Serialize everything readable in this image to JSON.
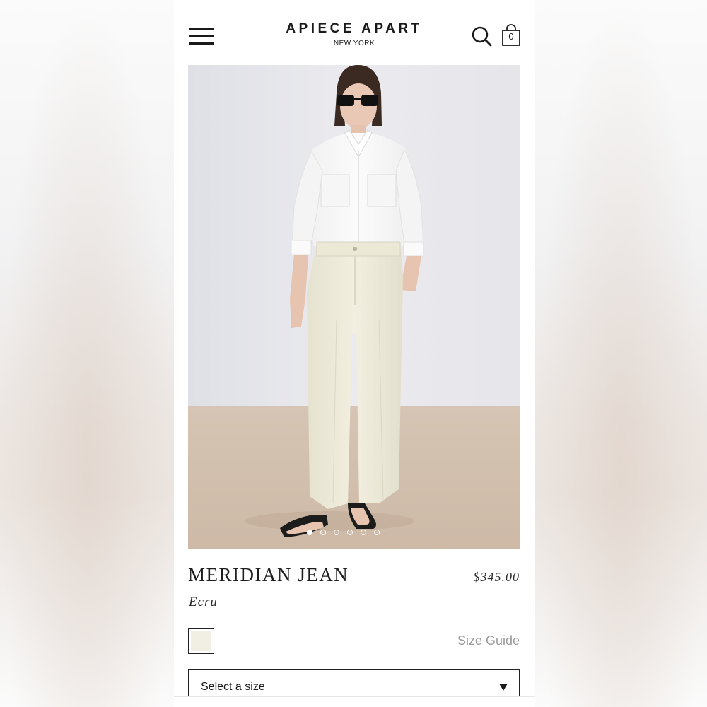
{
  "header": {
    "brand_name": "APIECE APART",
    "brand_location": "NEW YORK",
    "menu_icon": "hamburger-menu-icon",
    "search_icon": "search-icon",
    "bag_icon": "shopping-bag-icon",
    "bag_count": "0"
  },
  "gallery": {
    "image_count": 6,
    "active_index": 0
  },
  "product": {
    "name": "MERIDIAN JEAN",
    "price": "$345.00",
    "color_name": "Ecru",
    "swatch_color": "#f1efe4",
    "size_guide_label": "Size Guide",
    "size_select_placeholder": "Select a size"
  },
  "colors": {
    "text": "#1a1a1a",
    "muted": "#9a9a9a",
    "border": "#222222"
  }
}
